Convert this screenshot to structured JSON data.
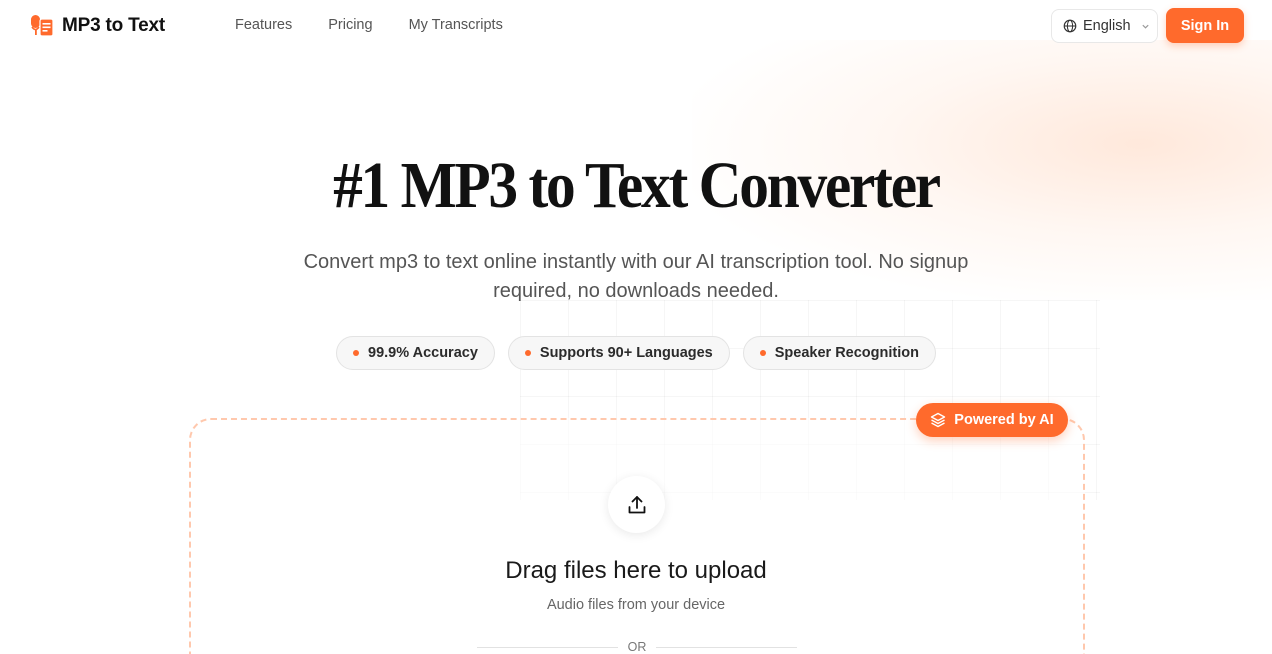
{
  "brand": {
    "name": "MP3 to Text",
    "accent": "#ff6a2c"
  },
  "nav": [
    {
      "label": "Features"
    },
    {
      "label": "Pricing"
    },
    {
      "label": "My Transcripts"
    }
  ],
  "language": {
    "selected": "English",
    "icon": "globe-icon"
  },
  "signin_label": "Sign In",
  "hero": {
    "title": "#1 MP3 to Text Converter",
    "subtitle": "Convert mp3 to text online instantly with our AI transcription tool. No signup required, no downloads needed."
  },
  "features": [
    {
      "label": "99.9% Accuracy"
    },
    {
      "label": "Supports 90+ Languages"
    },
    {
      "label": "Speaker Recognition"
    }
  ],
  "upload": {
    "badge": "Powered by AI",
    "icon": "upload-icon",
    "title": "Drag files here to upload",
    "subtitle": "Audio files from your device",
    "divider": "OR"
  }
}
